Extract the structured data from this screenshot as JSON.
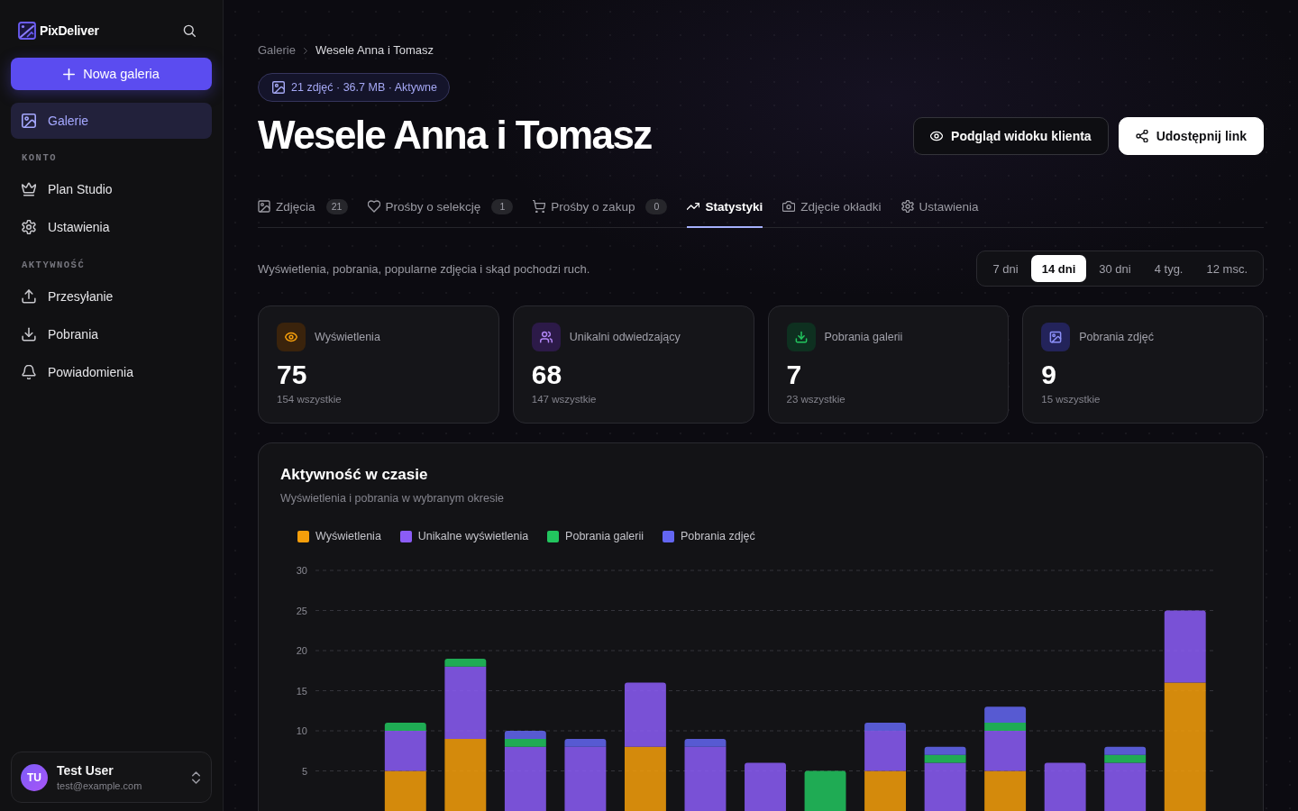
{
  "sidebar": {
    "brand": "PixDeliver",
    "new_gallery_button": "Nowa galeria",
    "nav": [
      {
        "label": "Galerie",
        "selected": true
      }
    ],
    "sections": [
      {
        "title": "KONTO",
        "items": [
          {
            "label": "Plan Studio",
            "selected": false
          },
          {
            "label": "Ustawienia",
            "selected": false
          }
        ]
      },
      {
        "title": "AKTYWNOŚĆ",
        "items": [
          {
            "label": "Przesyłanie",
            "selected": false
          },
          {
            "label": "Pobrania",
            "selected": false
          },
          {
            "label": "Powiadomienia",
            "selected": false
          }
        ]
      }
    ],
    "user": {
      "initials": "TU",
      "name": "Test User",
      "email": "test@example.com"
    }
  },
  "breadcrumb": [
    "Galerie",
    "Wesele Anna i Tomasz"
  ],
  "summary": "21 zdjęć · 36.7 MB · Aktywne",
  "title": "Wesele Anna i Tomasz",
  "actions": [
    {
      "label": "Podgląd widoku klienta",
      "kind": "secondary"
    },
    {
      "label": "Udostępnij link",
      "kind": "primary"
    }
  ],
  "tabs": [
    {
      "label": "Zdjęcia",
      "count": "21",
      "selected": false
    },
    {
      "label": "Prośby o selekcję",
      "count": "1",
      "selected": false
    },
    {
      "label": "Prośby o zakup",
      "count": "0",
      "selected": false
    },
    {
      "label": "Statystyki",
      "selected": true
    },
    {
      "label": "Zdjęcie okładki",
      "selected": false
    },
    {
      "label": "Ustawienia",
      "selected": false
    }
  ],
  "description": "Wyświetlenia, pobrania, popularne zdjęcia i skąd pochodzi ruch.",
  "periods": [
    {
      "label": "7 dni",
      "selected": false
    },
    {
      "label": "14 dni",
      "selected": true
    },
    {
      "label": "30 dni",
      "selected": false
    },
    {
      "label": "4 tyg.",
      "selected": false
    },
    {
      "label": "12 msc.",
      "selected": false
    }
  ],
  "stats": [
    {
      "label": "Wyświetlenia",
      "value": "75",
      "total": "154 wszystkie"
    },
    {
      "label": "Unikalni odwiedzający",
      "value": "68",
      "total": "147 wszystkie"
    },
    {
      "label": "Pobrania galerii",
      "value": "7",
      "total": "23 wszystkie"
    },
    {
      "label": "Pobrania zdjęć",
      "value": "9",
      "total": "15 wszystkie"
    }
  ],
  "activity_chart": {
    "chart_data": {
      "type": "bar",
      "title": "Aktywność w czasie",
      "subtitle": "Wyświetlenia i pobrania w wybranym okresie",
      "stacked": true,
      "legend": "top",
      "grid": true,
      "categories": [
        null,
        null,
        null,
        null,
        null,
        null,
        null,
        null,
        null,
        null,
        null,
        null,
        null,
        null,
        null
      ],
      "series": [
        {
          "name": "Wyświetlenia",
          "color": "#f59e0b",
          "values": [
            null,
            5,
            9,
            0,
            0,
            8,
            0,
            0,
            0,
            5,
            0,
            5,
            0,
            0,
            16
          ]
        },
        {
          "name": "Unikalne wyświetlenia",
          "color": "#8b5cf6",
          "values": [
            null,
            5,
            9,
            8,
            8,
            8,
            8,
            6,
            0,
            5,
            6,
            5,
            6,
            6,
            9
          ]
        },
        {
          "name": "Pobrania galerii",
          "color": "#22c55e",
          "values": [
            null,
            1,
            1,
            1,
            0,
            0,
            0,
            0,
            5,
            0,
            1,
            1,
            0,
            1,
            0
          ]
        },
        {
          "name": "Pobrania zdjęć",
          "color": "#6366f1",
          "values": [
            null,
            0,
            0,
            1,
            1,
            0,
            1,
            0,
            0,
            1,
            1,
            2,
            0,
            1,
            0
          ]
        }
      ],
      "ylim": [
        0,
        30
      ],
      "yticks": [
        5,
        10,
        15,
        20,
        25,
        30
      ]
    }
  }
}
